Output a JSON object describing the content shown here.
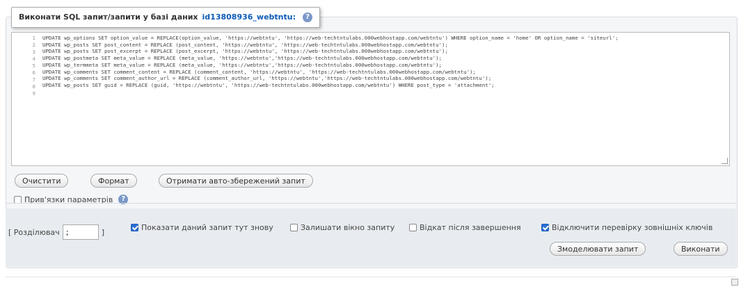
{
  "legend": {
    "prefix": "Виконати SQL запит/запити у базі даних",
    "database": "id13808936_webtntu:"
  },
  "editor": {
    "line_numbers": [
      "1",
      "2",
      "3",
      "4",
      "5",
      "6",
      "7",
      "8",
      "9"
    ],
    "lines": [
      "UPDATE wp_options SET option_value = REPLACE(option_value, 'https://webtntu', 'https://web-techtntulabs.000webhostapp.com/webtntu') WHERE option_name = 'home' OR option_name = 'siteurl';",
      "UPDATE wp_posts SET post_content = REPLACE (post_content, 'https://webtntu', 'https://web-techtntulabs.000webhostapp.com/webtntu');",
      "UPDATE wp_posts SET post_excerpt = REPLACE (post_excerpt, 'https://webtntu', 'https://web-techtntulabs.000webhostapp.com/webtntu');",
      "UPDATE wp_postmeta SET meta_value = REPLACE (meta_value, 'https://webtntu','https://web-techtntulabs.000webhostapp.com/webtntu');",
      "UPDATE wp_termmeta SET meta_value = REPLACE (meta_value, 'https://webtntu','https://web-techtntulabs.000webhostapp.com/webtntu');",
      "UPDATE wp_comments SET comment_content = REPLACE (comment_content, 'https://webtntu', 'https://web-techtntulabs.000webhostapp.com/webtntu');",
      "UPDATE wp_comments SET comment_author_url = REPLACE (comment_author_url, 'https://webtntu','https://web-techtntulabs.000webhostapp.com/webtntu');",
      "UPDATE wp_posts SET guid = REPLACE (guid, 'https://webtntu', 'https://web-techtntulabs.000webhostapp.com/webtntu') WHERE post_type = 'attachment';",
      ""
    ]
  },
  "buttons": {
    "clear": "Очистити",
    "format": "Формат",
    "get_autosaved": "Отримати авто-збережений запит",
    "simulate": "Змоделювати запит",
    "execute": "Виконати"
  },
  "bind_params": {
    "label": "Прив'язки параметрів",
    "checked": false
  },
  "options": {
    "delimiter_label": "[ Розділювач",
    "delimiter_close": "]",
    "delimiter_value": ";",
    "show_query_again": {
      "label": "Показати даний запит тут знову",
      "checked": true
    },
    "retain_query_box": {
      "label": "Залишати вікно запиту",
      "checked": false
    },
    "rollback_on_finish": {
      "label": "Відкат після завершення",
      "checked": false
    },
    "disable_fk_checks": {
      "label": "Відключити перевірку зовнішніх ключів",
      "checked": true
    }
  },
  "colors": {
    "accent": "#2a6fd6",
    "panel_bg": "#f4f6f8",
    "options_bg": "#e8ecf0"
  }
}
